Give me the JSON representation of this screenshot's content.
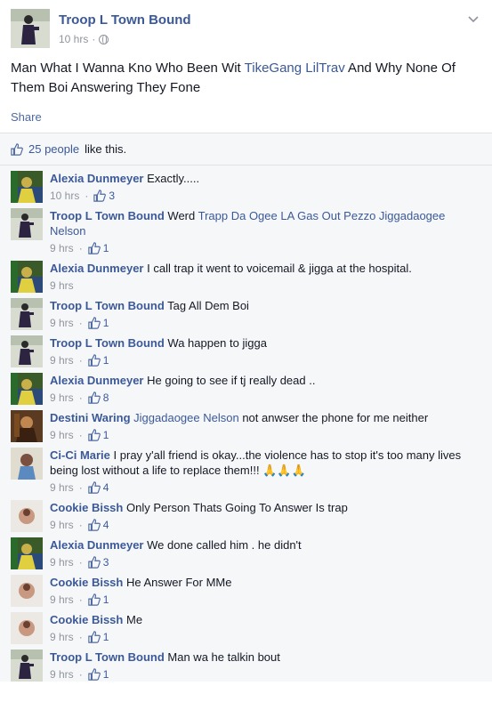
{
  "post": {
    "author": "Troop L Town Bound",
    "time": "10 hrs",
    "dot": "·",
    "text_before": "Man What I Wanna Kno Who Been Wit ",
    "tag": "TikeGang LilTrav",
    "text_after": " And Why None Of Them Boi Answering They Fone",
    "share_label": "Share"
  },
  "likes": {
    "count": "25 people",
    "suffix": "like this."
  },
  "comments": [
    {
      "author": "Alexia Dunmeyer",
      "avatar": "green",
      "text": "Exactly.....",
      "time": "10 hrs",
      "likes": "3"
    },
    {
      "author": "Troop L Town Bound",
      "avatar": "troop",
      "tags": "Trapp Da Ogee LA Gas Out Pezzo Jiggadaogee Nelson",
      "text": "Werd",
      "time": "9 hrs",
      "likes": "1"
    },
    {
      "author": "Alexia Dunmeyer",
      "avatar": "green",
      "text": "I call trap it went to voicemail & jigga at the hospital.",
      "time": "9 hrs",
      "likes": ""
    },
    {
      "author": "Troop L Town Bound",
      "avatar": "troop",
      "text": "Tag All Dem Boi",
      "time": "9 hrs",
      "likes": "1"
    },
    {
      "author": "Troop L Town Bound",
      "avatar": "troop",
      "text": "Wa happen to jigga",
      "time": "9 hrs",
      "likes": "1"
    },
    {
      "author": "Alexia Dunmeyer",
      "avatar": "green",
      "text": "He going to see if tj really dead ..",
      "time": "9 hrs",
      "likes": "8"
    },
    {
      "author": "Destini Waring",
      "avatar": "destini",
      "tags": "Jiggadaogee Nelson",
      "text": "not anwser the phone for me neither",
      "time": "9 hrs",
      "likes": "1"
    },
    {
      "author": "Ci-Ci Marie",
      "avatar": "cici",
      "text": "I pray y'all friend is okay...the violence has to stop it's too many lives being lost without a life to replace them!!!",
      "emoji": "🙏🙏🙏",
      "time": "9 hrs",
      "likes": "4"
    },
    {
      "author": "Cookie Bissh",
      "avatar": "cookie",
      "text": "Only Person Thats Going To Answer Is trap",
      "time": "9 hrs",
      "likes": "4"
    },
    {
      "author": "Alexia Dunmeyer",
      "avatar": "green",
      "text": "We done called him . he didn't",
      "time": "9 hrs",
      "likes": "3"
    },
    {
      "author": "Cookie Bissh",
      "avatar": "cookie",
      "text": "He Answer For MMe",
      "time": "9 hrs",
      "likes": "1"
    },
    {
      "author": "Cookie Bissh",
      "avatar": "cookie",
      "text": "Me",
      "time": "9 hrs",
      "likes": "1"
    },
    {
      "author": "Troop L Town Bound",
      "avatar": "troop",
      "text": "Man wa he talkin bout",
      "time": "9 hrs",
      "likes": "1"
    }
  ],
  "colors": {
    "link": "#3b5998",
    "meta": "#90949c",
    "panel": "#f6f7f9"
  }
}
